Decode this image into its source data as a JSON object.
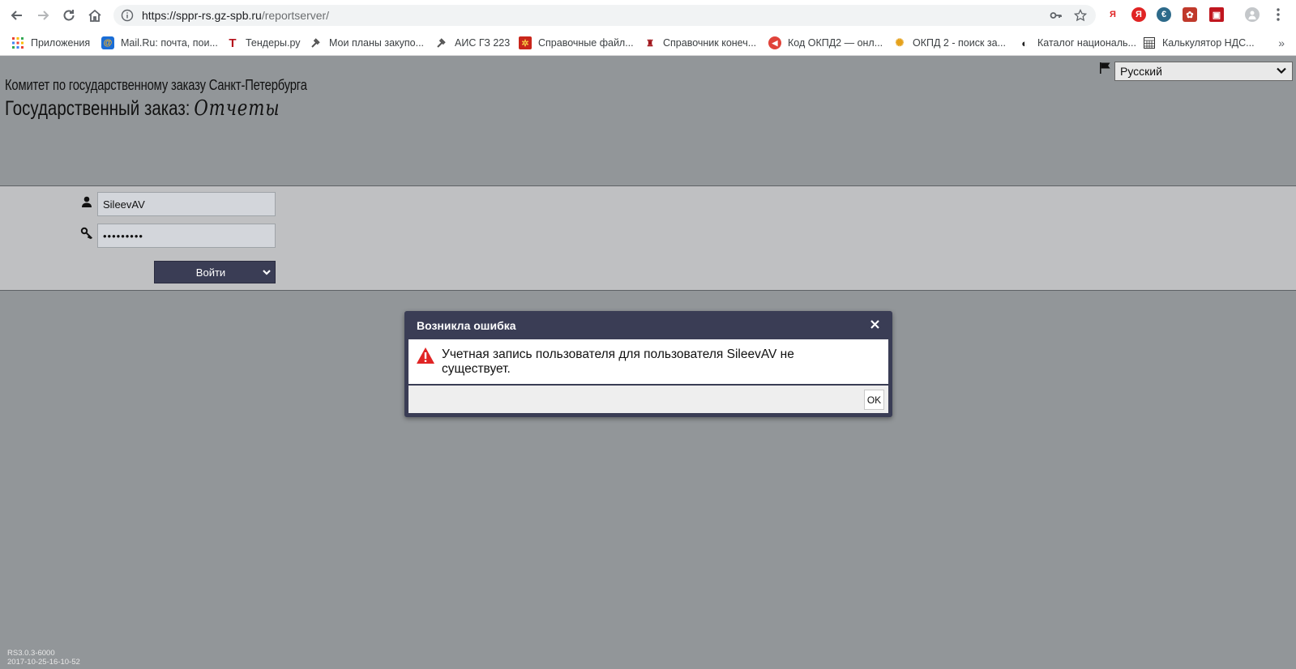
{
  "browser": {
    "url_host": "https://sppr-rs.gz-spb.ru",
    "url_path": "/reportserver/",
    "bookmarks": [
      {
        "label": "Приложения",
        "icon": "apps-grid-icon"
      },
      {
        "label": "Mail.Ru: почта, пои...",
        "icon": "mailru-icon"
      },
      {
        "label": "Тендеры.ру",
        "icon": "tendery-icon"
      },
      {
        "label": "Мои планы закупо...",
        "icon": "gavel-icon"
      },
      {
        "label": "АИС ГЗ 223",
        "icon": "gavel-icon"
      },
      {
        "label": "Справочные файл...",
        "icon": "spb-emblem-icon"
      },
      {
        "label": "Справочник конеч...",
        "icon": "spb-coat-icon"
      },
      {
        "label": "Код ОКПД2 — онл...",
        "icon": "red-circle-icon"
      },
      {
        "label": "ОКПД 2 - поиск за...",
        "icon": "okpd-icon"
      },
      {
        "label": "Каталог националь...",
        "icon": "catalog-icon"
      },
      {
        "label": "Калькулятор НДС...",
        "icon": "calculator-icon"
      }
    ],
    "more_label": "»"
  },
  "header": {
    "organization": "Комитет по государственному заказу Санкт-Петербурга",
    "title_prefix": "Государственный заказ:",
    "title_script": "Отчеты"
  },
  "language": {
    "selected": "Русский"
  },
  "login": {
    "username_value": "SileevAV",
    "password_value": "•••••••••",
    "login_label": "Войти"
  },
  "dialog": {
    "title": "Возникла ошибка",
    "message": "Учетная запись пользователя для пользователя SileevAV не существует.",
    "ok_label": "OK"
  },
  "footer": {
    "version": "RS3.0.3-6000",
    "build_date": "2017-10-25-16-10-52"
  },
  "colors": {
    "page_bg": "#929699",
    "login_band": "#bfc0c2",
    "dialog_frame": "#3a3d55",
    "button_bg": "#3a3d55",
    "warning_red": "#e02424"
  }
}
